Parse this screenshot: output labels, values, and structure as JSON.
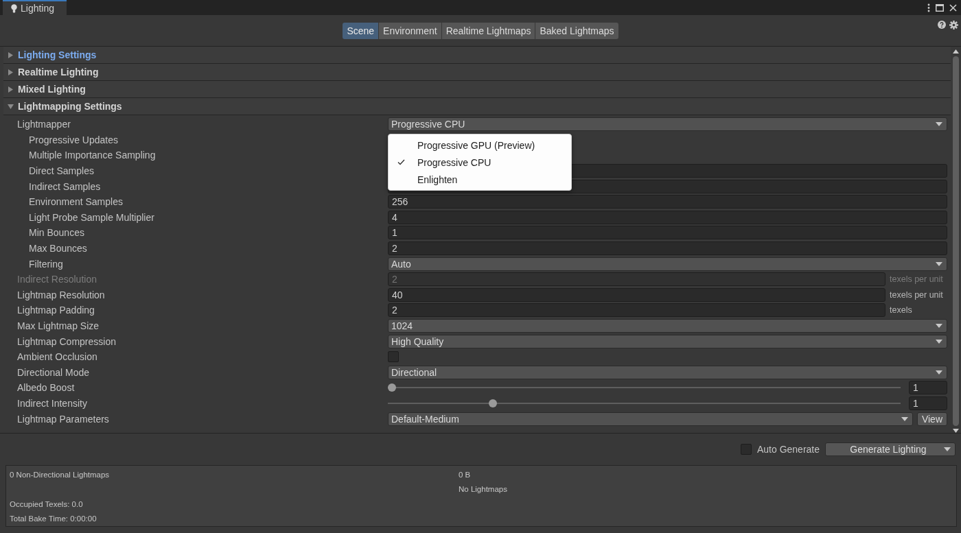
{
  "window": {
    "title": "Lighting"
  },
  "tabs": [
    {
      "label": "Scene",
      "selected": true
    },
    {
      "label": "Environment",
      "selected": false
    },
    {
      "label": "Realtime Lightmaps",
      "selected": false
    },
    {
      "label": "Baked Lightmaps",
      "selected": false
    }
  ],
  "sections": [
    {
      "label": "Lighting Settings",
      "expanded": false,
      "selected": true
    },
    {
      "label": "Realtime Lighting",
      "expanded": false,
      "selected": false
    },
    {
      "label": "Mixed Lighting",
      "expanded": false,
      "selected": false
    },
    {
      "label": "Lightmapping Settings",
      "expanded": true,
      "selected": false
    }
  ],
  "rows": [
    {
      "label": "Lightmapper",
      "kind": "dropdown",
      "value": "Progressive CPU",
      "children": [
        {
          "label": "Progressive Updates",
          "kind": "covered"
        },
        {
          "label": "Multiple Importance Sampling",
          "kind": "covered"
        },
        {
          "label": "Direct Samples",
          "kind": "field"
        },
        {
          "label": "Indirect Samples",
          "kind": "field"
        },
        {
          "label": "Environment Samples",
          "kind": "field",
          "value": "256"
        },
        {
          "label": "Light Probe Sample Multiplier",
          "kind": "field",
          "value": "4"
        },
        {
          "label": "Min Bounces",
          "kind": "field",
          "value": "1"
        },
        {
          "label": "Max Bounces",
          "kind": "field",
          "value": "2"
        },
        {
          "label": "Filtering",
          "kind": "dropdown",
          "value": "Auto"
        }
      ]
    },
    {
      "label": "Indirect Resolution",
      "kind": "field",
      "value": "2",
      "unit": "texels per unit",
      "disabled": true
    },
    {
      "label": "Lightmap Resolution",
      "kind": "field",
      "value": "40",
      "unit": "texels per unit",
      "disabled": false
    },
    {
      "label": "Lightmap Padding",
      "kind": "field",
      "value": "2",
      "unit": "texels",
      "disabled": false
    },
    {
      "label": "Max Lightmap Size",
      "kind": "dropdown",
      "value": "1024"
    },
    {
      "label": "Lightmap Compression",
      "kind": "dropdown",
      "value": "High Quality"
    },
    {
      "label": "Ambient Occlusion",
      "kind": "checkbox",
      "checked": false
    },
    {
      "label": "Directional Mode",
      "kind": "dropdown",
      "value": "Directional"
    },
    {
      "label": "Albedo Boost",
      "kind": "slider",
      "level": 0,
      "value": "1"
    },
    {
      "label": "Indirect Intensity",
      "kind": "slider",
      "level": 0.2,
      "value": "1"
    },
    {
      "label": "Lightmap Parameters",
      "kind": "asset",
      "value": "Default-Medium",
      "button": "View"
    }
  ],
  "lightmapper_menu": [
    {
      "label": "Progressive GPU (Preview)",
      "checked": false
    },
    {
      "label": "Progressive CPU",
      "checked": true
    },
    {
      "label": "Enlighten",
      "checked": false
    }
  ],
  "bake": {
    "auto_generate": {
      "label": "Auto Generate",
      "checked": false
    },
    "generate_button": "Generate Lighting"
  },
  "stats": {
    "lightmaps": "0 Non-Directional Lightmaps",
    "size": "0 B",
    "preview": "No Lightmaps",
    "occupied_texels": "Occupied Texels: 0.0",
    "bake_time": "Total Bake Time: 0:00:00"
  }
}
